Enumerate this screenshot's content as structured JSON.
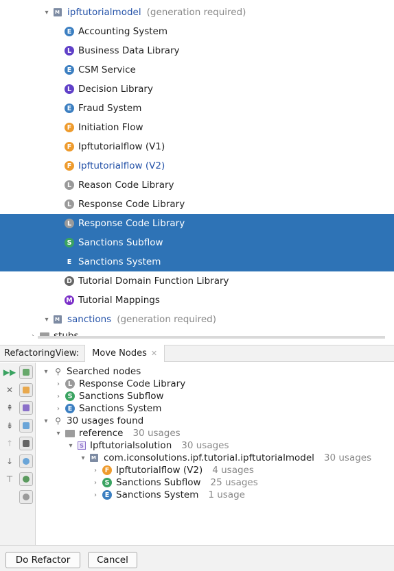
{
  "tree": {
    "module": {
      "name": "ipftutorialmodel",
      "note": "(generation required)"
    },
    "items": [
      {
        "badge": "E",
        "label": "Accounting System"
      },
      {
        "badge": "L",
        "label": "Business Data Library"
      },
      {
        "badge": "E",
        "label": "CSM Service"
      },
      {
        "badge": "L",
        "label": "Decision Library"
      },
      {
        "badge": "E",
        "label": "Fraud System"
      },
      {
        "badge": "F",
        "label": "Initiation Flow"
      },
      {
        "badge": "F",
        "label": "Ipftutorialflow (V1)"
      },
      {
        "badge": "F",
        "label": "Ipftutorialflow (V2)"
      },
      {
        "badge": "L",
        "label": "Reason Code Library"
      },
      {
        "badge": "L",
        "label": "Response Code Library"
      },
      {
        "badge": "L",
        "label": "Response Code Library"
      },
      {
        "badge": "S",
        "label": "Sanctions Subflow"
      },
      {
        "badge": "E",
        "label": "Sanctions System"
      },
      {
        "badge": "D",
        "label": "Tutorial Domain Function Library"
      },
      {
        "badge": "M",
        "label": "Tutorial Mappings"
      }
    ],
    "module2": {
      "name": "sanctions",
      "note": "(generation required)"
    },
    "stubs": "stubs"
  },
  "panel": {
    "title": "RefactoringView:",
    "tab": "Move Nodes",
    "searched": "Searched nodes",
    "searched_items": [
      {
        "badge": "L",
        "label": "Response Code Library"
      },
      {
        "badge": "S",
        "label": "Sanctions Subflow"
      },
      {
        "badge": "E",
        "label": "Sanctions System"
      }
    ],
    "usages": "30 usages found",
    "reference": {
      "label": "reference",
      "count": "30 usages"
    },
    "solution": {
      "label": "Ipftutorialsolution",
      "count": "30 usages"
    },
    "model": {
      "label": "com.iconsolutions.ipf.tutorial.ipftutorialmodel",
      "count": "30 usages"
    },
    "usage_items": [
      {
        "badge": "F",
        "label": "Ipftutorialflow (V2)",
        "count": "4 usages"
      },
      {
        "badge": "S",
        "label": "Sanctions Subflow",
        "count": "25 usages"
      },
      {
        "badge": "E",
        "label": "Sanctions System",
        "count": "1 usage"
      }
    ]
  },
  "buttons": {
    "refactor": "Do Refactor",
    "cancel": "Cancel"
  },
  "colors": {
    "selection": "#2e73b6",
    "entity": "#3c7fc1",
    "library": "#6040c8",
    "flow": "#ee9b2d",
    "subflow": "#3aa361"
  }
}
